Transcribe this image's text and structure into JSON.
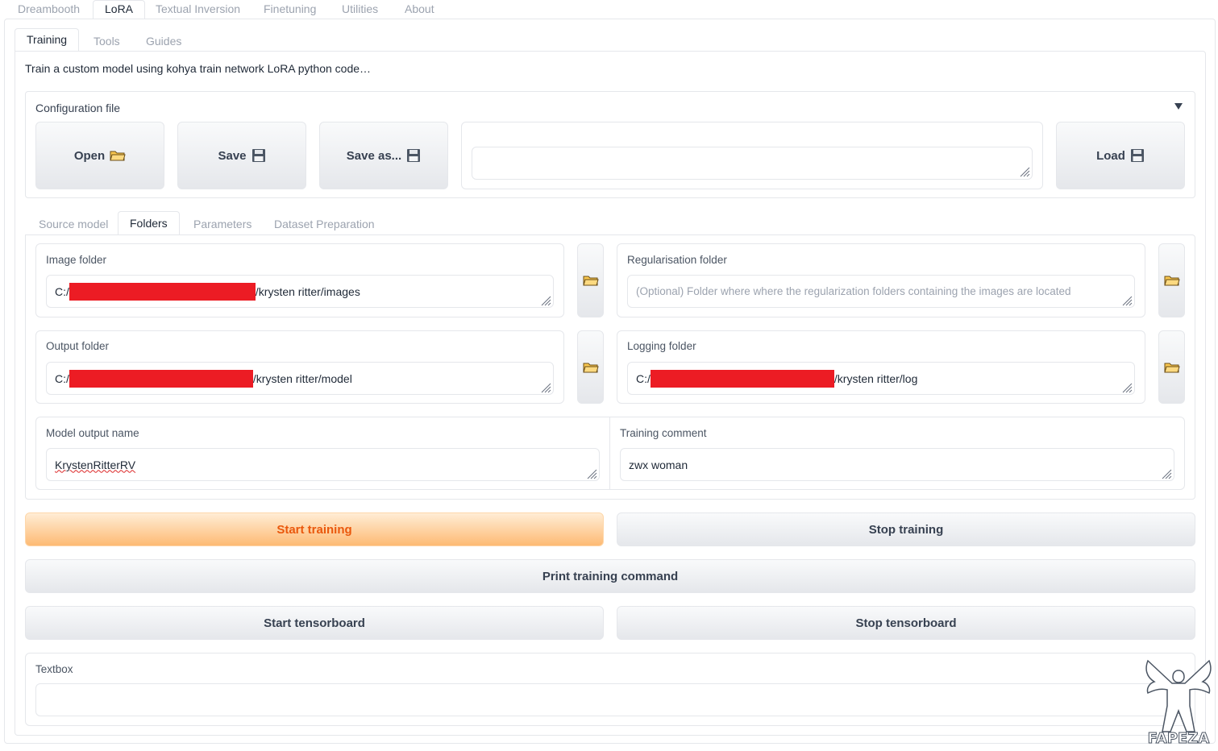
{
  "top_tabs": [
    "Dreambooth",
    "LoRA",
    "Textual Inversion",
    "Finetuning",
    "Utilities",
    "About"
  ],
  "sub_tabs": [
    "Training",
    "Tools",
    "Guides"
  ],
  "description": "Train a custom model using kohya train network LoRA python code…",
  "config": {
    "title": "Configuration file",
    "open_label": "Open",
    "save_label": "Save",
    "save_as_label": "Save as...",
    "load_label": "Load",
    "file_value": ""
  },
  "section_tabs": [
    "Source model",
    "Folders",
    "Parameters",
    "Dataset Preparation"
  ],
  "folders": {
    "image_label": "Image folder",
    "image_prefix": "C:/",
    "image_suffix": "/krysten ritter/images",
    "reg_label": "Regularisation folder",
    "reg_placeholder": "(Optional) Folder where where the regularization folders containing the images are located",
    "output_label": "Output folder",
    "output_prefix": "C:/",
    "output_suffix": "/krysten ritter/model",
    "logging_label": "Logging folder",
    "logging_prefix": "C:/",
    "logging_suffix": "/krysten ritter/log",
    "model_name_label": "Model output name",
    "model_name_value": "KrystenRitterRV",
    "comment_label": "Training comment",
    "comment_value": "zwx woman"
  },
  "buttons": {
    "start_training": "Start training",
    "stop_training": "Stop training",
    "print_command": "Print training command",
    "start_tensorboard": "Start tensorboard",
    "stop_tensorboard": "Stop tensorboard"
  },
  "textbox": {
    "label": "Textbox",
    "value": ""
  },
  "watermark": "FAPEZA",
  "colors": {
    "accent_orange": "#ea580c",
    "redaction_red": "#ec1c24"
  }
}
